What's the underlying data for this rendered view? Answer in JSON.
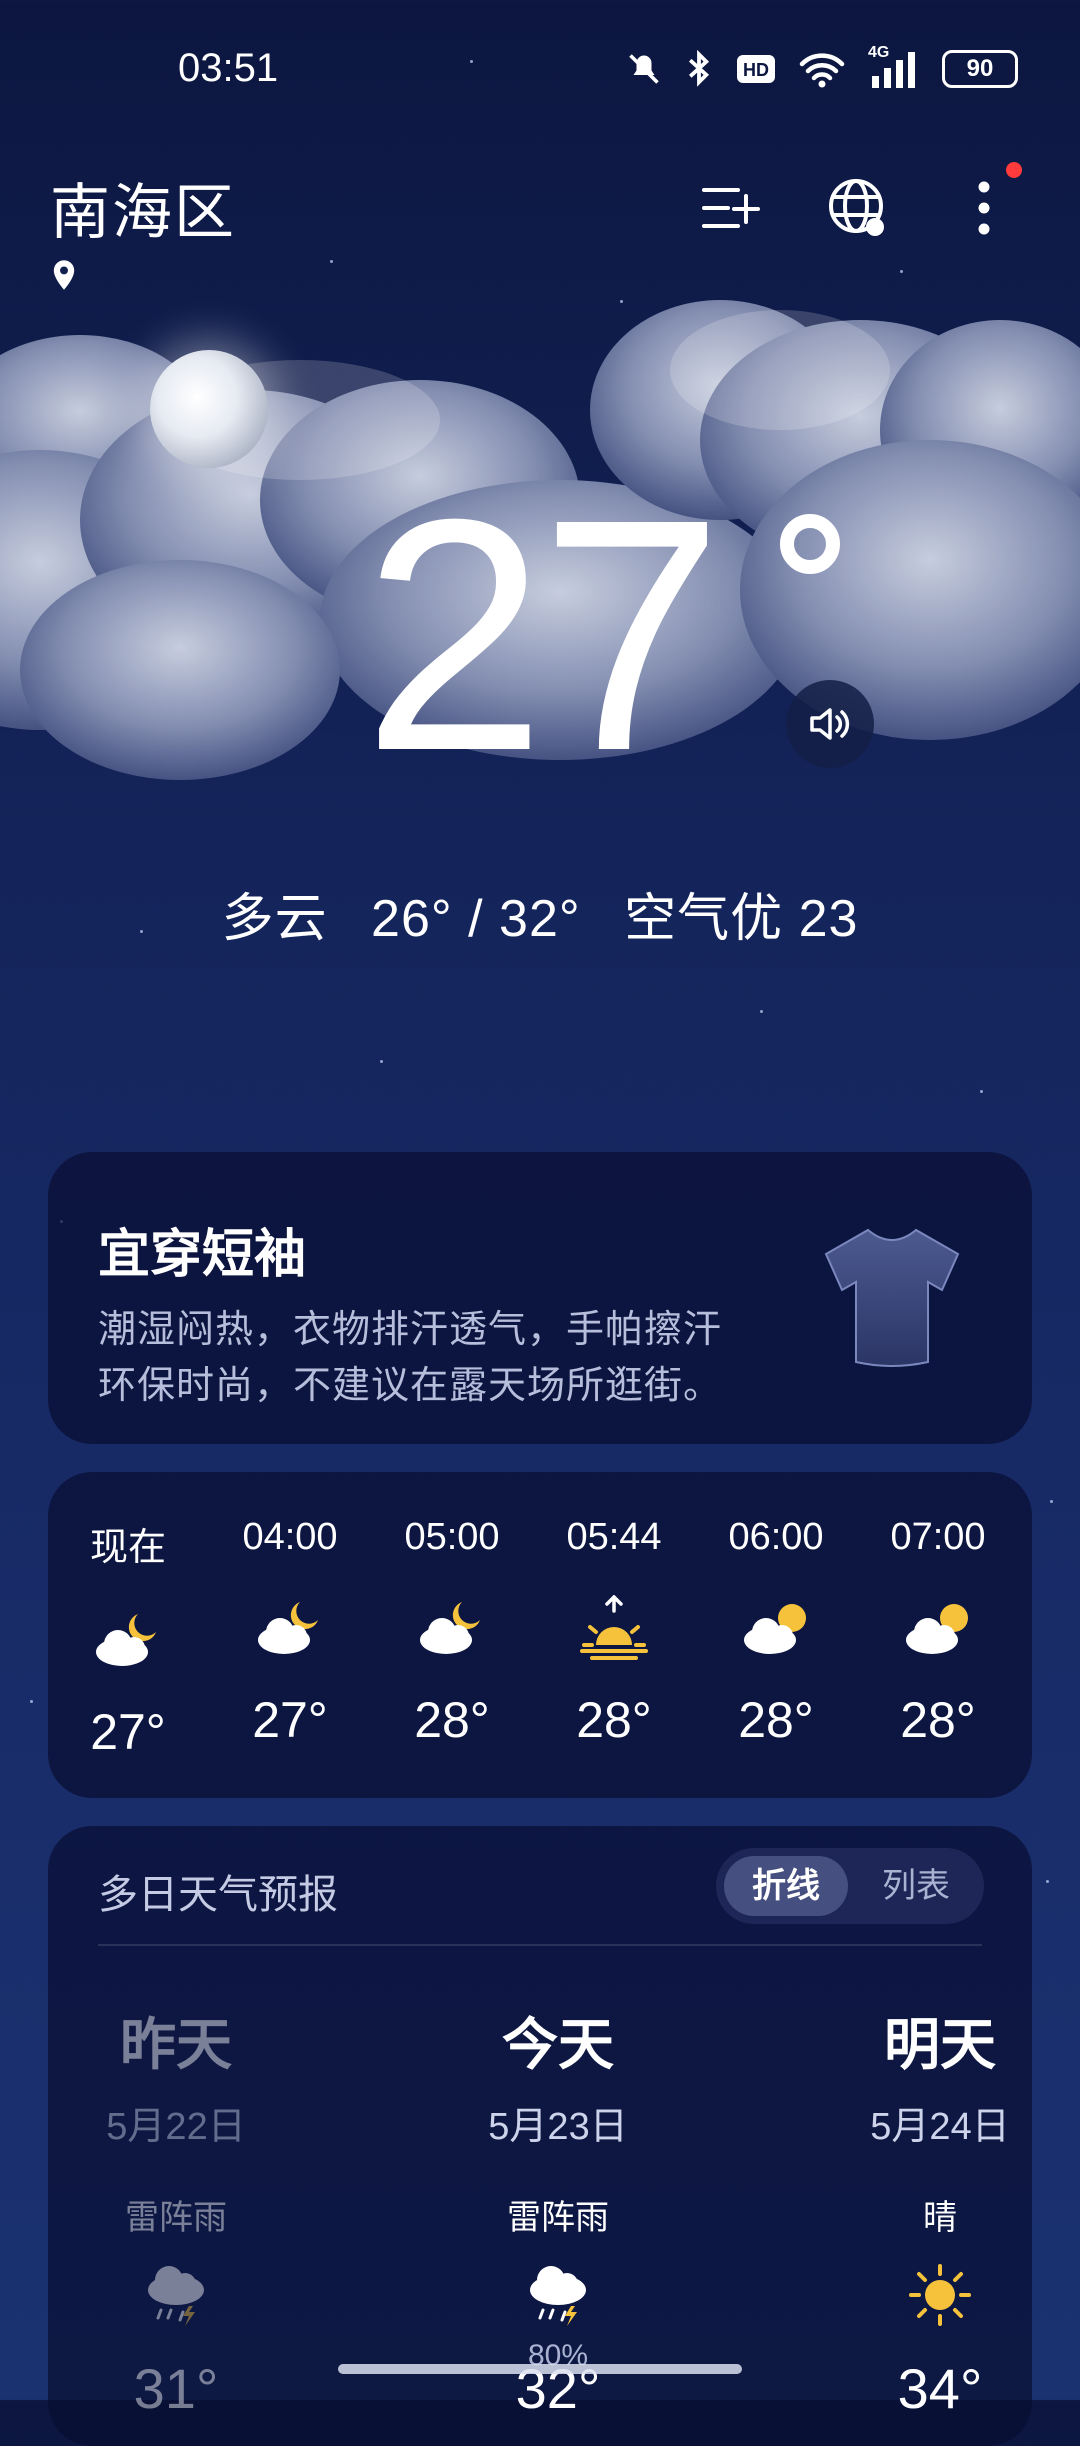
{
  "status_bar": {
    "time": "03:51",
    "battery": "90",
    "signal": "4G"
  },
  "header": {
    "city": "南海区"
  },
  "current": {
    "temperature": "27",
    "condition": "多云",
    "range": "26° / 32°",
    "air_quality": "空气优 23"
  },
  "clothing": {
    "title": "宜穿短袖",
    "line1": "潮湿闷热，衣物排汗透气，手帕擦汗",
    "line2": "环保时尚，不建议在露天场所逛街。"
  },
  "hourly": [
    {
      "time": "现在",
      "icon": "partly-cloudy-night-icon",
      "temp": "27°"
    },
    {
      "time": "04:00",
      "icon": "partly-cloudy-night-icon",
      "temp": "27°"
    },
    {
      "time": "05:00",
      "icon": "partly-cloudy-night-icon",
      "temp": "28°"
    },
    {
      "time": "05:44",
      "icon": "sunrise-icon",
      "temp": "28°"
    },
    {
      "time": "06:00",
      "icon": "partly-cloudy-day-icon",
      "temp": "28°"
    },
    {
      "time": "07:00",
      "icon": "partly-cloudy-day-icon",
      "temp": "28°"
    }
  ],
  "forecast": {
    "title": "多日天气预报",
    "toggle_line": "折线",
    "toggle_list": "列表",
    "days": [
      {
        "name": "昨天",
        "date": "5月22日",
        "condition": "雷阵雨",
        "icon": "thunderstorm-icon",
        "pop": "",
        "high": "31°"
      },
      {
        "name": "今天",
        "date": "5月23日",
        "condition": "雷阵雨",
        "icon": "thunderstorm-icon",
        "pop": "80%",
        "high": "32°"
      },
      {
        "name": "明天",
        "date": "5月24日",
        "condition": "晴",
        "icon": "sun-icon",
        "pop": "",
        "high": "34°"
      }
    ]
  }
}
